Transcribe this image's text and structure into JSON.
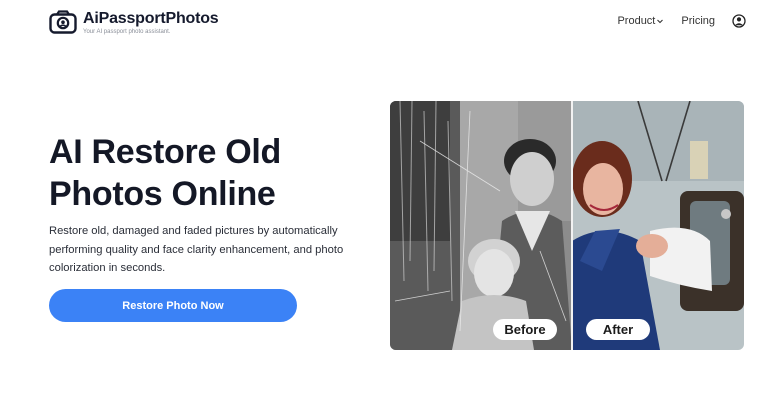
{
  "brand": {
    "name": "AiPassportPhotos",
    "tagline": "Your AI passport photo assistant.",
    "icon": "camera-logo-icon"
  },
  "nav": {
    "product_label": "Product",
    "pricing_label": "Pricing",
    "product_icon": "chevron-down-icon",
    "account_icon": "user-circle-icon"
  },
  "hero": {
    "title_line1": "AI Restore Old",
    "title_line2": "Photos Online",
    "description": "Restore old, damaged and faded pictures by automatically performing quality and face clarity enhancement, and photo colorization in seconds.",
    "cta_label": "Restore Photo Now",
    "cta_color": "#3b82f6"
  },
  "comparison": {
    "before_label": "Before",
    "after_label": "After",
    "split_fraction": 0.52
  }
}
